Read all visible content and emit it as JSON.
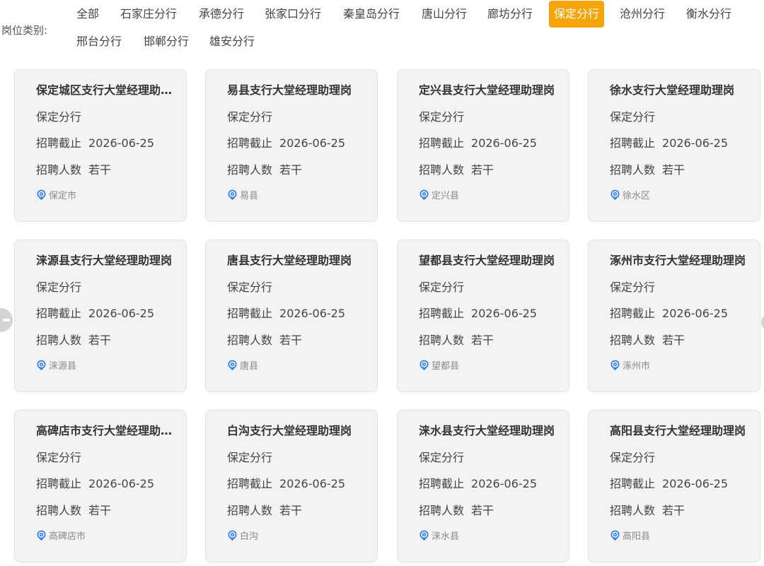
{
  "filter": {
    "label": "岗位类别:",
    "tabs": [
      {
        "label": "全部"
      },
      {
        "label": "石家庄分行"
      },
      {
        "label": "承德分行"
      },
      {
        "label": "张家口分行"
      },
      {
        "label": "秦皇岛分行"
      },
      {
        "label": "唐山分行"
      },
      {
        "label": "廊坊分行"
      },
      {
        "label": "保定分行",
        "active": true
      },
      {
        "label": "沧州分行"
      },
      {
        "label": "衡水分行"
      },
      {
        "label": "邢台分行"
      },
      {
        "label": "邯郸分行"
      },
      {
        "label": "雄安分行"
      }
    ],
    "active_color": "#f5a50a"
  },
  "card_labels": {
    "deadline": "招聘截止",
    "headcount": "招聘人数",
    "location_icon": "location-pin-icon",
    "icon_color": "#2b7de9"
  },
  "jobs": [
    {
      "title": "保定城区支行大堂经理助理岗",
      "branch": "保定分行",
      "deadline": "2026-06-25",
      "headcount": "若干",
      "location": "保定市"
    },
    {
      "title": "易县支行大堂经理助理岗",
      "branch": "保定分行",
      "deadline": "2026-06-25",
      "headcount": "若干",
      "location": "易县"
    },
    {
      "title": "定兴县支行大堂经理助理岗",
      "branch": "保定分行",
      "deadline": "2026-06-25",
      "headcount": "若干",
      "location": "定兴县"
    },
    {
      "title": "徐水支行大堂经理助理岗",
      "branch": "保定分行",
      "deadline": "2026-06-25",
      "headcount": "若干",
      "location": "徐水区"
    },
    {
      "title": "涞源县支行大堂经理助理岗",
      "branch": "保定分行",
      "deadline": "2026-06-25",
      "headcount": "若干",
      "location": "涞源县"
    },
    {
      "title": "唐县支行大堂经理助理岗",
      "branch": "保定分行",
      "deadline": "2026-06-25",
      "headcount": "若干",
      "location": "唐县"
    },
    {
      "title": "望都县支行大堂经理助理岗",
      "branch": "保定分行",
      "deadline": "2026-06-25",
      "headcount": "若干",
      "location": "望都县"
    },
    {
      "title": "涿州市支行大堂经理助理岗",
      "branch": "保定分行",
      "deadline": "2026-06-25",
      "headcount": "若干",
      "location": "涿州市"
    },
    {
      "title": "高碑店市支行大堂经理助理岗",
      "branch": "保定分行",
      "deadline": "2026-06-25",
      "headcount": "若干",
      "location": "高碑店市"
    },
    {
      "title": "白沟支行大堂经理助理岗",
      "branch": "保定分行",
      "deadline": "2026-06-25",
      "headcount": "若干",
      "location": "白沟"
    },
    {
      "title": "涞水县支行大堂经理助理岗",
      "branch": "保定分行",
      "deadline": "2026-06-25",
      "headcount": "若干",
      "location": "涞水县"
    },
    {
      "title": "高阳县支行大堂经理助理岗",
      "branch": "保定分行",
      "deadline": "2026-06-25",
      "headcount": "若干",
      "location": "高阳县"
    }
  ]
}
